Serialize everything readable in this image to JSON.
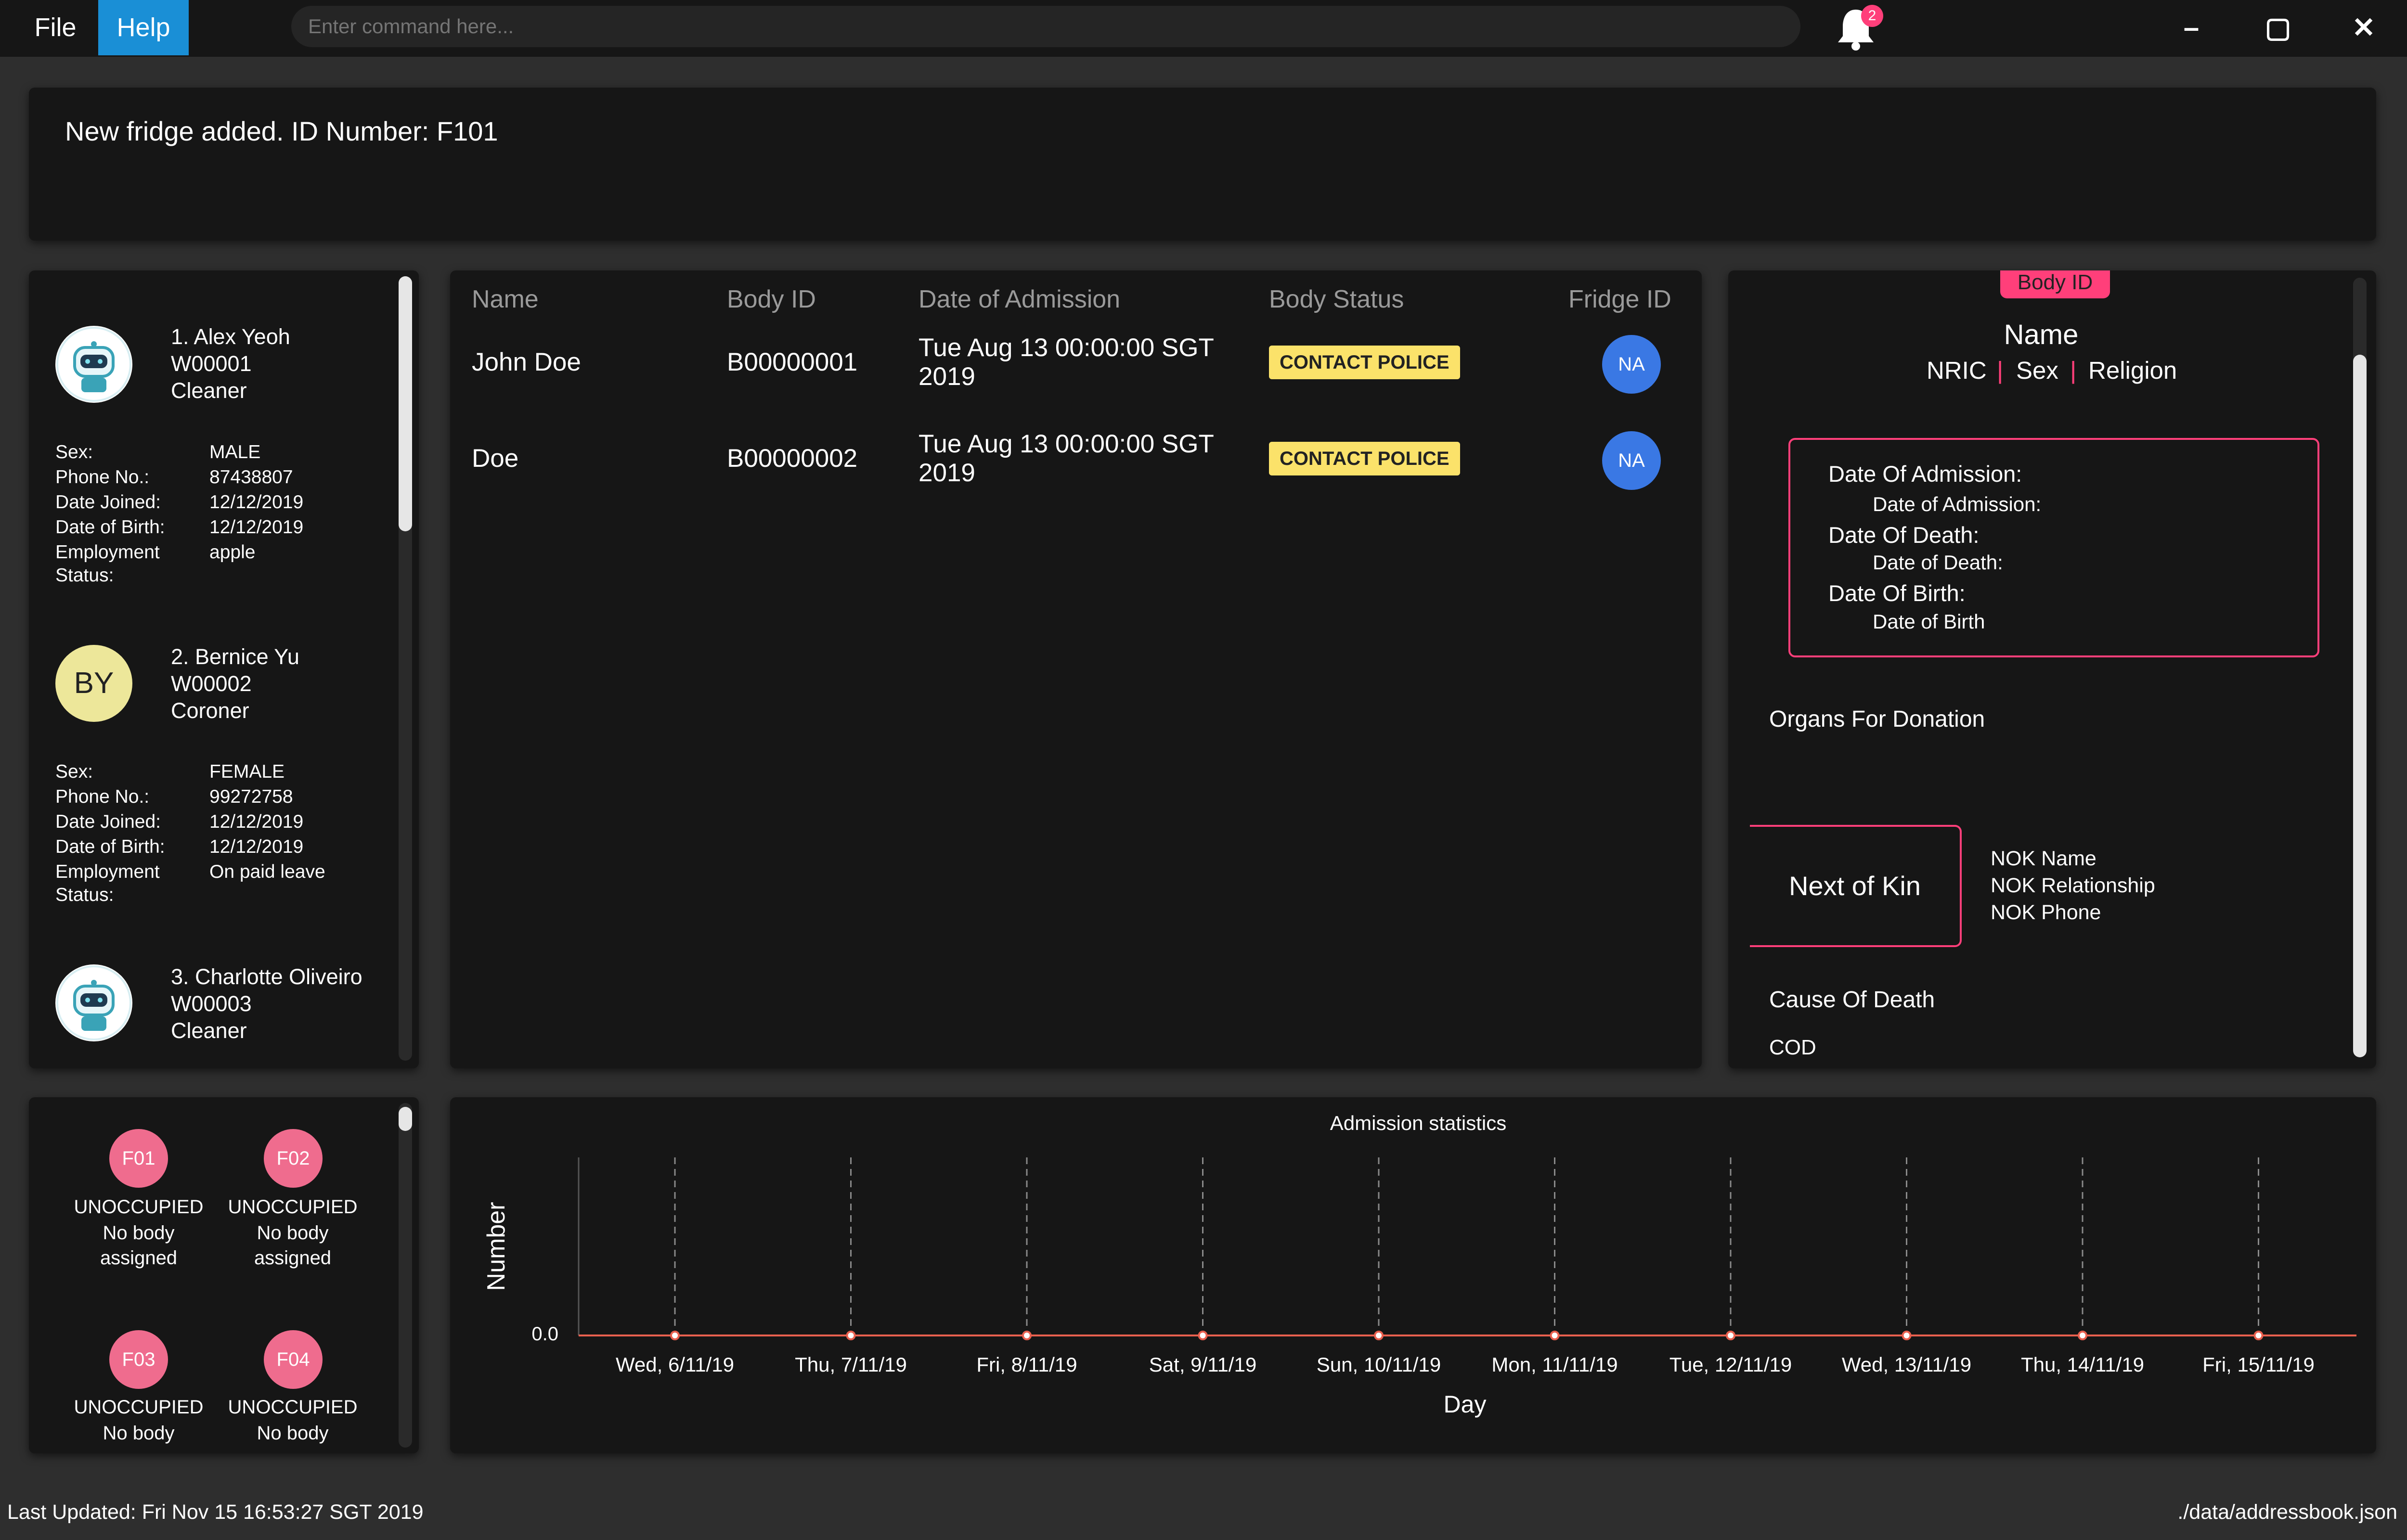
{
  "menu": {
    "file": "File",
    "help": "Help"
  },
  "command": {
    "placeholder": "Enter command here..."
  },
  "notifications": {
    "count": "2"
  },
  "window": {
    "minimize": "–",
    "maximize": "▢",
    "close": "✕"
  },
  "result": {
    "text": "New fridge added. ID Number: F101"
  },
  "staff": [
    {
      "title": "1. Alex Yeoh",
      "id": "W00001",
      "role": "Cleaner",
      "avatar": "robot",
      "sex": "MALE",
      "phone": "87438807",
      "joined": "12/12/2019",
      "dob": "12/12/2019",
      "employment": "apple"
    },
    {
      "title": "2. Bernice Yu",
      "id": "W00002",
      "role": "Coroner",
      "avatar": "BY",
      "sex": "FEMALE",
      "phone": "99272758",
      "joined": "12/12/2019",
      "dob": "12/12/2019",
      "employment": "On paid leave"
    },
    {
      "title": "3. Charlotte Oliveiro",
      "id": "W00003",
      "role": "Cleaner",
      "avatar": "robot"
    }
  ],
  "staff_labels": {
    "sex": "Sex:",
    "phone": "Phone No.:",
    "joined": "Date Joined:",
    "dob": "Date of Birth:",
    "emp1": "Employment",
    "emp2": "Status:"
  },
  "table": {
    "headers": [
      "Name",
      "Body ID",
      "Date of Admission",
      "Body Status",
      "Fridge ID"
    ],
    "rows": [
      {
        "name": "John Doe",
        "id": "B00000001",
        "date1": "Tue Aug 13 00:00:00 SGT",
        "date2": "2019",
        "status": "CONTACT POLICE",
        "fridge": "NA"
      },
      {
        "name": "Doe",
        "id": "B00000002",
        "date1": "Tue Aug 13 00:00:00 SGT",
        "date2": "2019",
        "status": "CONTACT POLICE",
        "fridge": "NA"
      }
    ]
  },
  "detail": {
    "badge": "Body ID",
    "name": "Name",
    "nric": "NRIC",
    "sex": "Sex",
    "religion": "Religion",
    "sep": "|",
    "doa_label": "Date Of Admission:",
    "doa_val": "Date of Admission:",
    "dod_label": "Date Of Death:",
    "dod_val": "Date of Death:",
    "dob_label": "Date Of Birth:",
    "dob_val": "Date of Birth",
    "organs": "Organs For Donation",
    "nok_title": "Next of Kin",
    "nok_name": "NOK Name",
    "nok_rel": "NOK Relationship",
    "nok_phone": "NOK Phone",
    "cod_title": "Cause Of Death",
    "cod": "COD"
  },
  "fridges": [
    {
      "id": "F01",
      "status": "UNOCCUPIED",
      "line1": "No body",
      "line2": "assigned"
    },
    {
      "id": "F02",
      "status": "UNOCCUPIED",
      "line1": "No body",
      "line2": "assigned"
    },
    {
      "id": "F03",
      "status": "UNOCCUPIED",
      "line1": "No body",
      "line2": ""
    },
    {
      "id": "F04",
      "status": "UNOCCUPIED",
      "line1": "No body",
      "line2": ""
    }
  ],
  "chart_data": {
    "type": "line",
    "title": "Admission statistics",
    "xlabel": "Day",
    "ylabel": "Number",
    "categories": [
      "Wed, 6/11/19",
      "Thu, 7/11/19",
      "Fri, 8/11/19",
      "Sat, 9/11/19",
      "Sun, 10/11/19",
      "Mon, 11/11/19",
      "Tue, 12/11/19",
      "Wed, 13/11/19",
      "Thu, 14/11/19",
      "Fri, 15/11/19"
    ],
    "values": [
      0,
      0,
      0,
      0,
      0,
      0,
      0,
      0,
      0,
      0
    ],
    "yticks": [
      "0.0"
    ],
    "grid": "vertical dashed",
    "line_color": "#e8604f"
  },
  "status": {
    "updated": "Last Updated: Fri Nov 15 16:53:27 SGT 2019",
    "path": "./data/addressbook.json"
  },
  "colors": {
    "accent": "#ff3f7a",
    "help_bg": "#1a8fd6",
    "badge_yellow": "#fbe26a",
    "fridge_pink": "#ef6c8e",
    "na_blue": "#3a78e4"
  }
}
